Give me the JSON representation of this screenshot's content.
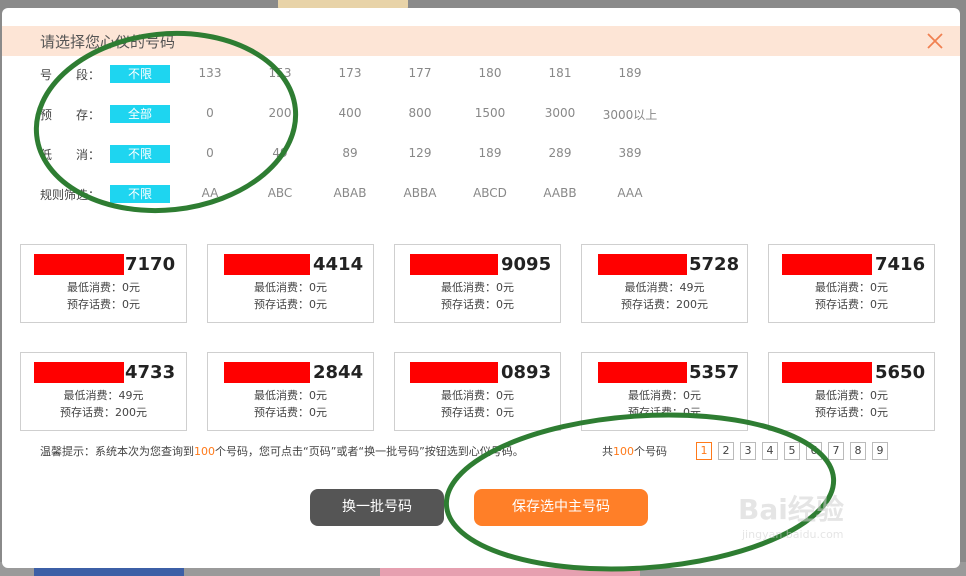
{
  "modal": {
    "title": "请选择您心仪的号码"
  },
  "filters": [
    {
      "label": "号　　段：",
      "options": [
        "不限",
        "133",
        "153",
        "173",
        "177",
        "180",
        "181",
        "189"
      ],
      "active_index": 0
    },
    {
      "label": "预　　存：",
      "options": [
        "全部",
        "0",
        "200",
        "400",
        "800",
        "1500",
        "3000",
        "3000以上"
      ],
      "active_index": 0
    },
    {
      "label": "低　　消：",
      "options": [
        "不限",
        "0",
        "49",
        "89",
        "129",
        "189",
        "289",
        "389"
      ],
      "active_index": 0
    },
    {
      "label": "规则筛选：",
      "options": [
        "不限",
        "AA",
        "ABC",
        "ABAB",
        "ABBA",
        "ABCD",
        "AABB",
        "AAA"
      ],
      "active_index": 0
    }
  ],
  "cards": [
    {
      "suffix": "7170",
      "min_fee": "最低消费：0元",
      "prestore": "预存话费：0元"
    },
    {
      "suffix": "4414",
      "min_fee": "最低消费：0元",
      "prestore": "预存话费：0元"
    },
    {
      "suffix": "9095",
      "min_fee": "最低消费：0元",
      "prestore": "预存话费：0元"
    },
    {
      "suffix": "5728",
      "min_fee": "最低消费：49元",
      "prestore": "预存话费：200元"
    },
    {
      "suffix": "7416",
      "min_fee": "最低消费：0元",
      "prestore": "预存话费：0元"
    },
    {
      "suffix": "4733",
      "min_fee": "最低消费：49元",
      "prestore": "预存话费：200元"
    },
    {
      "suffix": "2844",
      "min_fee": "最低消费：0元",
      "prestore": "预存话费：0元"
    },
    {
      "suffix": "0893",
      "min_fee": "最低消费：0元",
      "prestore": "预存话费：0元"
    },
    {
      "suffix": "5357",
      "min_fee": "最低消费：0元",
      "prestore": "预存话费：0元"
    },
    {
      "suffix": "5650",
      "min_fee": "最低消费：0元",
      "prestore": "预存话费：0元"
    }
  ],
  "tip": {
    "prefix": "温馨提示：系统本次为您查询到",
    "count": "100",
    "suffix": "个号码，您可点击“页码”或者“换一批号码”按钮选到心仪号码。"
  },
  "total": {
    "prefix": "共",
    "count": "100",
    "suffix": "个号码"
  },
  "pagination": {
    "pages": [
      "1",
      "2",
      "3",
      "4",
      "5",
      "6",
      "7",
      "8",
      "9"
    ],
    "active_index": 0
  },
  "buttons": {
    "refresh": "换一批号码",
    "save": "保存选中主号码"
  },
  "watermark": {
    "main": "Bai经验",
    "sub": "jingyan.baidu.com"
  },
  "colors": {
    "accent": "#ff7f28",
    "active_filter": "#1ed5f0",
    "redaction": "#ff0000",
    "annotation": "#2e7d32"
  }
}
